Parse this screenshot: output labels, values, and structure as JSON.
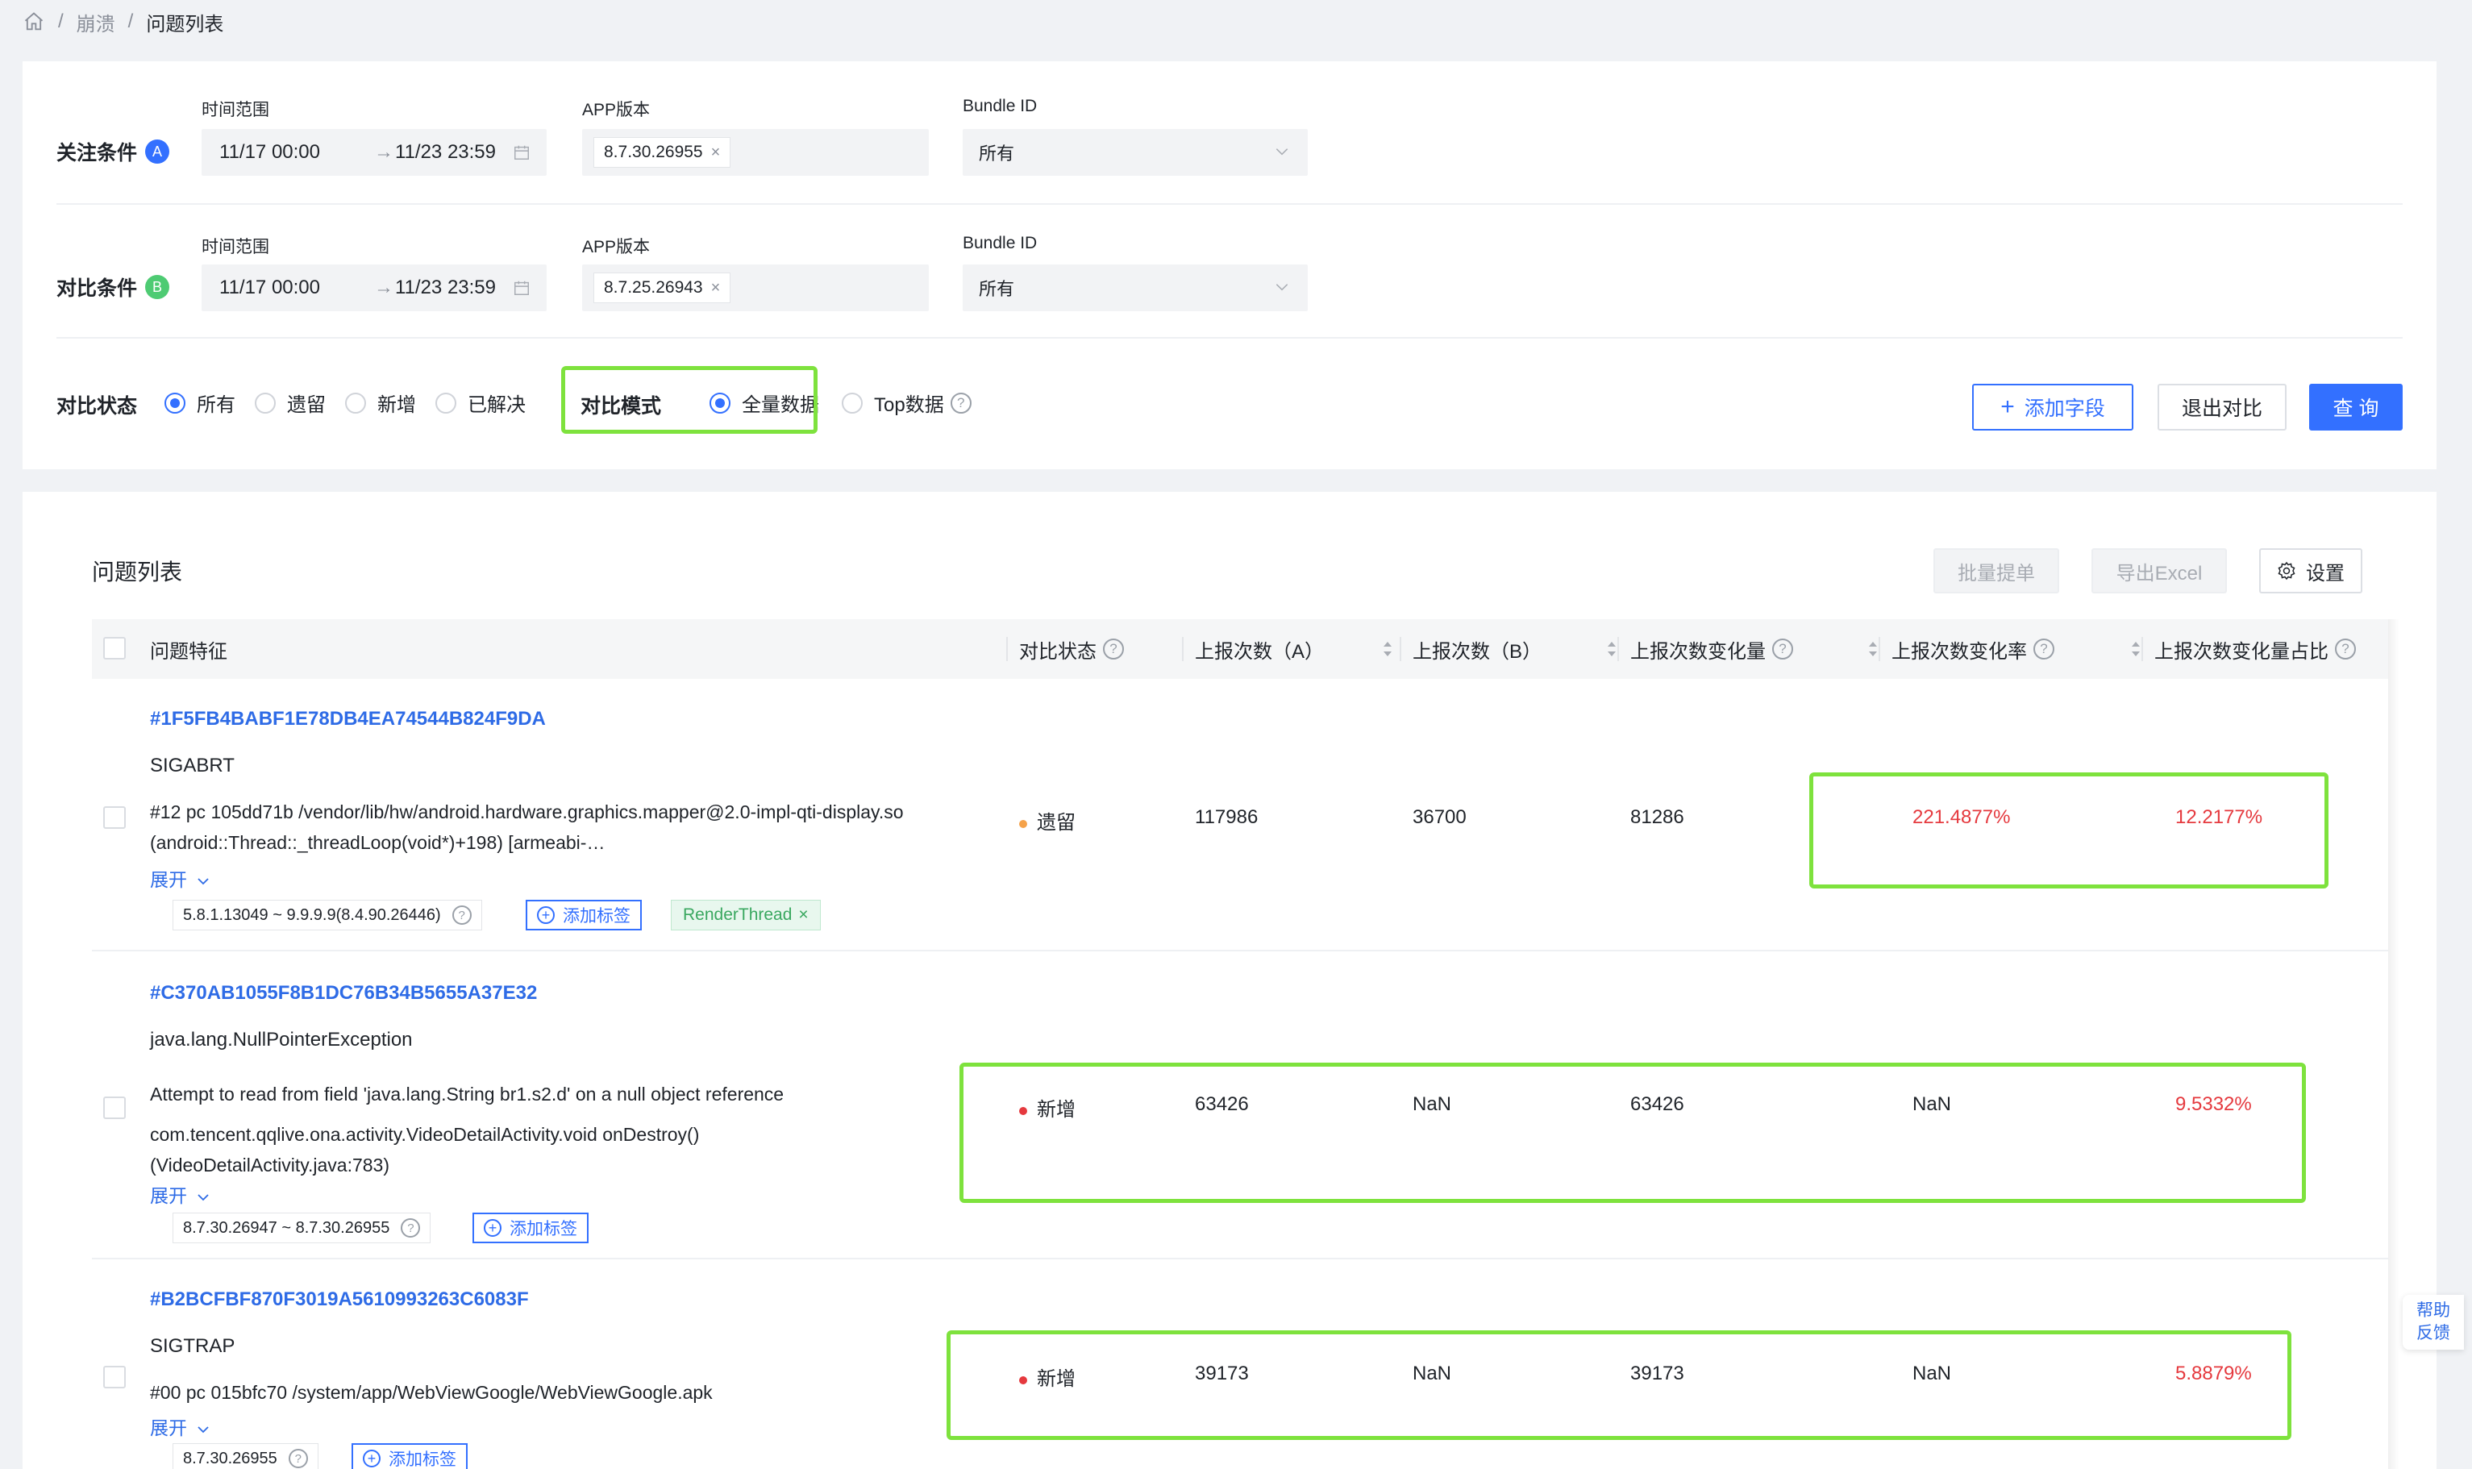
{
  "breadcrumb": {
    "item1": "崩溃",
    "item2": "问题列表",
    "sep": "/"
  },
  "condA": {
    "label": "关注条件",
    "badge": "A",
    "time_label": "时间范围",
    "time_start": "11/17 00:00",
    "time_arrow": "→",
    "time_end": "11/23 23:59",
    "version_label": "APP版本",
    "version_tag": "8.7.30.26955",
    "bundle_label": "Bundle ID",
    "bundle_value": "所有"
  },
  "condB": {
    "label": "对比条件",
    "badge": "B",
    "time_label": "时间范围",
    "time_start": "11/17 00:00",
    "time_arrow": "→",
    "time_end": "11/23 23:59",
    "version_label": "APP版本",
    "version_tag": "8.7.25.26943",
    "bundle_label": "Bundle ID",
    "bundle_value": "所有"
  },
  "compare_status": {
    "label": "对比状态",
    "options": [
      "所有",
      "遗留",
      "新增",
      "已解决"
    ],
    "selected": "所有"
  },
  "compare_mode": {
    "label": "对比模式",
    "options": [
      "全量数据",
      "Top数据"
    ],
    "selected": "全量数据",
    "help": "?"
  },
  "buttons": {
    "add_field": "添加字段",
    "exit_compare": "退出对比",
    "query": "查 询",
    "batch": "批量提单",
    "export": "导出Excel",
    "settings": "设置"
  },
  "list": {
    "title": "问题列表",
    "columns": [
      "问题特征",
      "对比状态",
      "上报次数（A）",
      "上报次数（B）",
      "上报次数变化量",
      "上报次数变化率",
      "上报次数变化量占比"
    ],
    "expand_label": "展开",
    "add_tag_label": "添加标签",
    "issues": [
      {
        "id": "#1F5FB4BABF1E78DB4EA74544B824F9DA",
        "type": "SIGABRT",
        "desc1": "#12 pc 105dd71b /vendor/lib/hw/android.hardware.graphics.mapper@2.0-impl-qti-display.so",
        "desc2": "(android::Thread::_threadLoop(void*)+198) [armeabi-…",
        "version": "5.8.1.13049 ~ 9.9.9.9(8.4.90.26446)",
        "thread_tag": "RenderThread",
        "status": "遗留",
        "count_a": "117986",
        "count_b": "36700",
        "delta": "81286",
        "rate": "221.4877%",
        "share": "12.2177%"
      },
      {
        "id": "#C370AB1055F8B1DC76B34B5655A37E32",
        "type": "java.lang.NullPointerException",
        "desc1": "Attempt to read from field 'java.lang.String br1.s2.d' on a null object reference",
        "desc2": "com.tencent.qqlive.ona.activity.VideoDetailActivity.void onDestroy()",
        "desc3": "(VideoDetailActivity.java:783)",
        "version": "8.7.30.26947 ~ 8.7.30.26955",
        "status": "新增",
        "count_a": "63426",
        "count_b": "NaN",
        "delta": "63426",
        "rate": "NaN",
        "share": "9.5332%"
      },
      {
        "id": "#B2BCFBF870F3019A5610993263C6083F",
        "type": "SIGTRAP",
        "desc1": "#00 pc 015bfc70 /system/app/WebViewGoogle/WebViewGoogle.apk",
        "version": "8.7.30.26955",
        "status": "新增",
        "count_a": "39173",
        "count_b": "NaN",
        "delta": "39173",
        "rate": "NaN",
        "share": "5.8879%"
      }
    ]
  },
  "help_feedback": {
    "line1": "帮助",
    "line2": "反馈"
  },
  "colors": {
    "accent": "#3370ff",
    "highlight": "#7ee23d",
    "danger": "#e5393e",
    "legacy_dot": "#f5a24a",
    "new_dot": "#e5393e"
  }
}
